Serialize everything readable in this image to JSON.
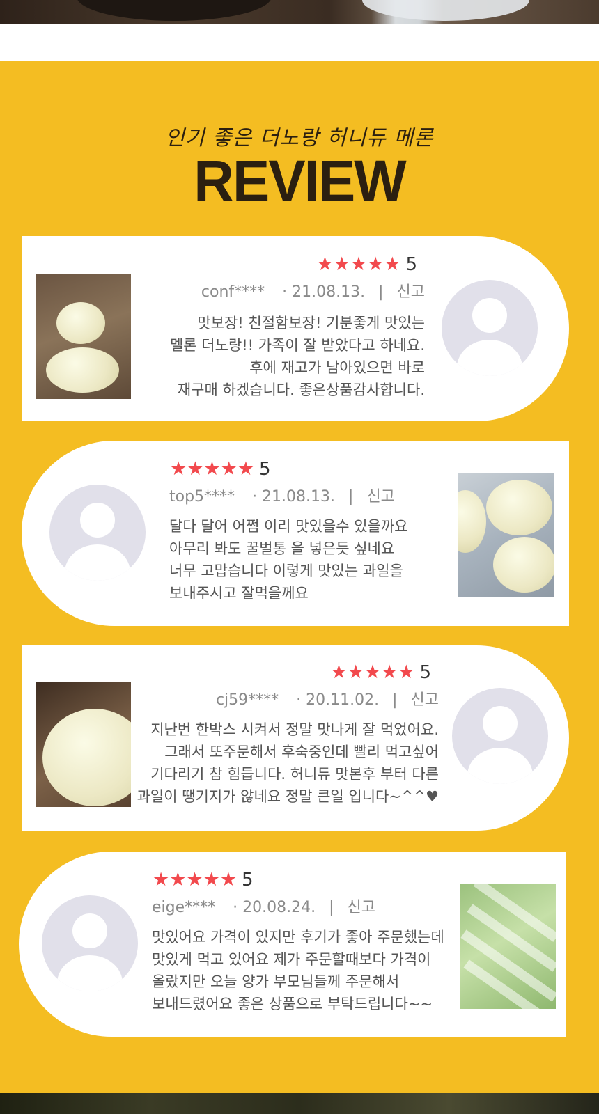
{
  "header": {
    "subtitle": "인기 좋은 더노랑 허니듀 메론",
    "title": "REVIEW"
  },
  "colors": {
    "background": "#f4bd22",
    "star": "#f2494d",
    "avatar": "#e1e0ea",
    "title": "#2b1f10"
  },
  "reviews": [
    {
      "rating": 5,
      "stars": "★★★★★",
      "user": "conf****",
      "date": "· 21.08.13.",
      "separator": "|",
      "report": "신고",
      "text": "맛보장! 친절함보장! 기분좋게 맛있는\n멜론 더노랑!! 가족이 잘 받았다고 하네요.\n후에 재고가 남아있으면 바로\n재구매 하겠습니다. 좋은상품감사합니다."
    },
    {
      "rating": 5,
      "stars": "★★★★★",
      "user": "top5****",
      "date": "· 21.08.13.",
      "separator": "|",
      "report": "신고",
      "text": "달다 달어 어쩜 이리 맛있을수 있을까요\n아무리 봐도 꿀벌통 을 넣은듯 싶네요\n너무 고맙습니다 이렇게 맛있는 과일을\n보내주시고 잘먹을께요"
    },
    {
      "rating": 5,
      "stars": "★★★★★",
      "user": "cj59****",
      "date": "· 20.11.02.",
      "separator": "|",
      "report": "신고",
      "text": "지난번 한박스 시켜서 정말 맛나게 잘 먹었어요.\n그래서 또주문해서 후숙중인데 빨리 먹고싶어\n기다리기 참  힘듭니다. 허니듀 맛본후 부터 다른\n과일이 땡기지가 않네요 정말 큰일 입니다~^^♥"
    },
    {
      "rating": 5,
      "stars": "★★★★★",
      "user": "eige****",
      "date": "· 20.08.24.",
      "separator": "|",
      "report": "신고",
      "text": "맛있어요 가격이 있지만 후기가 좋아 주문했는데\n맛있게 먹고 있어요 제가 주문할때보다 가격이\n올랐지만 오늘 양가 부모님들께 주문해서\n보내드렸어요 좋은 상품으로 부탁드립니다~~"
    }
  ]
}
